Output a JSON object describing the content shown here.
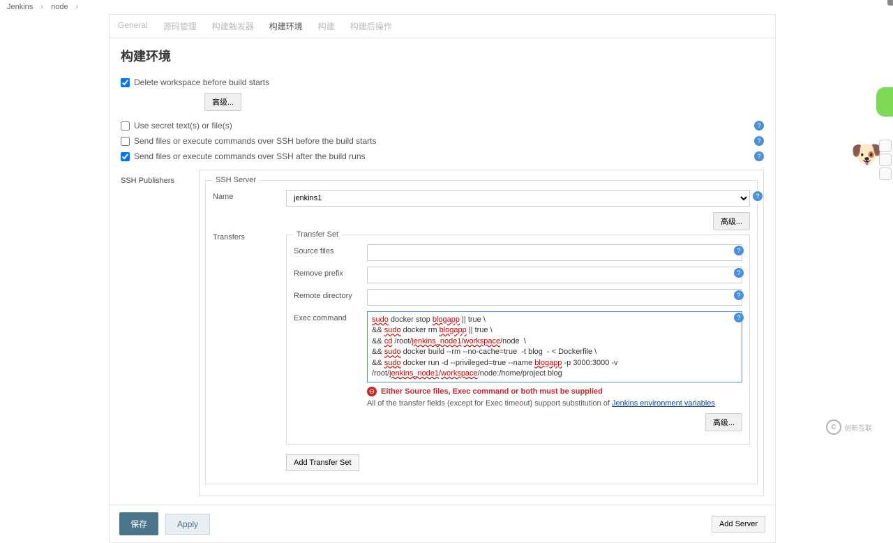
{
  "breadcrumb": {
    "root": "Jenkins",
    "item": "node"
  },
  "tabs": {
    "general": "General",
    "scm": "源码管理",
    "triggers": "构建触发器",
    "env": "构建环境",
    "build": "构建",
    "post": "构建后操作"
  },
  "section_title": "构建环境",
  "options": {
    "delete_ws": "Delete workspace before build starts",
    "use_secret": "Use secret text(s) or file(s)",
    "send_before": "Send files or execute commands over SSH before the build starts",
    "send_after": "Send files or execute commands over SSH after the build runs"
  },
  "advanced_label": "高级...",
  "ssh": {
    "publishers_label": "SSH Publishers",
    "server_legend": "SSH Server",
    "name_label": "Name",
    "name_value": "jenkins1",
    "transfers_label": "Transfers",
    "transfer_set_legend": "Transfer Set",
    "source_files_label": "Source files",
    "remove_prefix_label": "Remove prefix",
    "remote_dir_label": "Remote directory",
    "exec_label": "Exec command",
    "add_transfer_set": "Add Transfer Set",
    "add_server": "Add Server"
  },
  "exec_lines": [
    "sudo docker stop blogapp || true \\",
    "&& sudo docker rm blogapp || true \\",
    "&& cd /root/jenkins_node1/workspace/node  \\",
    "&& sudo docker build --rm --no-cache=true  -t blog  - < Dockerfile \\",
    "&& sudo docker run -d --privileged=true --name blogapp -p 3000:3000 -v /root/jenkins_node1/workspace/node:/home/project blog"
  ],
  "error_text": "Either Source files, Exec command or both must be supplied",
  "info_prefix": "All of the transfer fields (except for Exec timeout) support substitution of ",
  "info_link": "Jenkins environment variables",
  "footer": {
    "save": "保存",
    "apply": "Apply"
  },
  "logo_text": "创新互联"
}
